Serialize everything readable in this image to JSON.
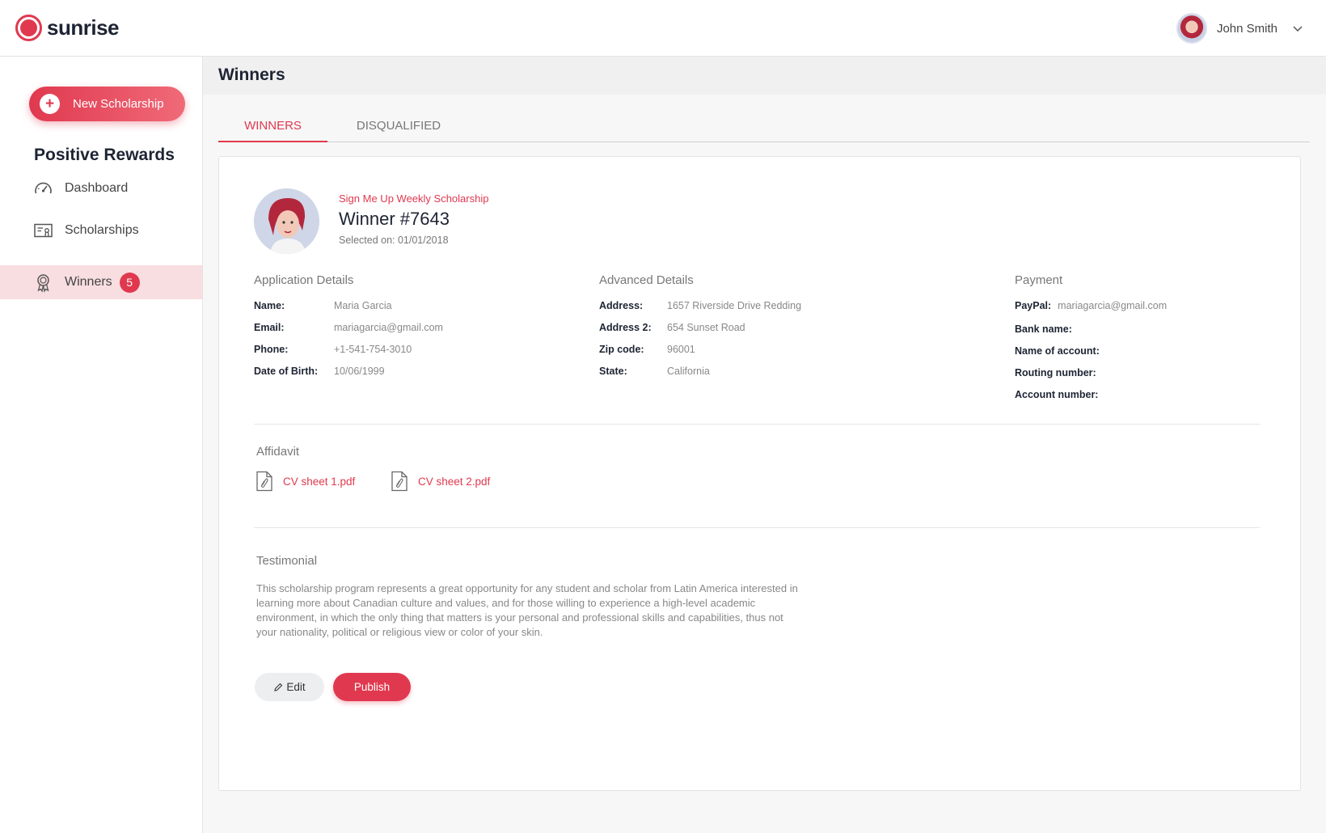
{
  "app": {
    "brand": "sunrise",
    "accent": "#e0394f"
  },
  "user": {
    "name": "John Smith",
    "avatar_icon": "user-avatar",
    "menu_icon": "chevron-down-icon"
  },
  "sidebar": {
    "new_button_label": "New Scholarship",
    "org_title": "Positive Rewards",
    "items": [
      {
        "label": "Dashboard",
        "icon": "speedometer-icon"
      },
      {
        "label": "Scholarships",
        "icon": "certificate-icon"
      },
      {
        "label": "Winners",
        "icon": "award-icon",
        "badge": "5",
        "active": true
      }
    ]
  },
  "page": {
    "title": "Winners",
    "tabs": [
      {
        "label": "WINNERS",
        "active": true
      },
      {
        "label": "DISQUALIFIED",
        "active": false
      }
    ]
  },
  "winner": {
    "scholarship": "Sign Me Up Weekly Scholarship",
    "title": "Winner #7643",
    "selected_on": "Selected on: 01/01/2018"
  },
  "application": {
    "title": "Application Details",
    "fields": [
      {
        "key": "Name:",
        "value": "Maria Garcia"
      },
      {
        "key": "Email:",
        "value": "mariagarcia@gmail.com"
      },
      {
        "key": "Phone:",
        "value": "+1-541-754-3010"
      },
      {
        "key": "Date of Birth:",
        "value": "10/06/1999"
      }
    ]
  },
  "advanced": {
    "title": "Advanced Details",
    "fields": [
      {
        "key": "Address:",
        "value": "1657 Riverside Drive Redding"
      },
      {
        "key": "Address 2:",
        "value": "654 Sunset Road"
      },
      {
        "key": "Zip code:",
        "value": "96001"
      },
      {
        "key": "State:",
        "value": "California"
      }
    ]
  },
  "payment": {
    "title": "Payment",
    "fields": [
      {
        "key": "PayPal:",
        "value": "mariagarcia@gmail.com"
      },
      {
        "key": "Bank name:",
        "value": ""
      },
      {
        "key": "Name of account:",
        "value": ""
      },
      {
        "key": "Routing number:",
        "value": ""
      },
      {
        "key": "Account number:",
        "value": ""
      }
    ]
  },
  "affidavit": {
    "title": "Affidavit",
    "files": [
      "CV sheet 1.pdf",
      "CV sheet 2.pdf"
    ]
  },
  "testimonial": {
    "title": "Testimonial",
    "text": "This scholarship program represents a great opportunity for any student and scholar from Latin America interested in learning more about Canadian culture and values, and for those willing to experience a high-level academic environment, in which the only thing that matters is your personal and professional skills and capabilities, thus not your nationality, political or religious view or color of your skin."
  },
  "actions": {
    "edit_label": "Edit",
    "publish_label": "Publish"
  }
}
